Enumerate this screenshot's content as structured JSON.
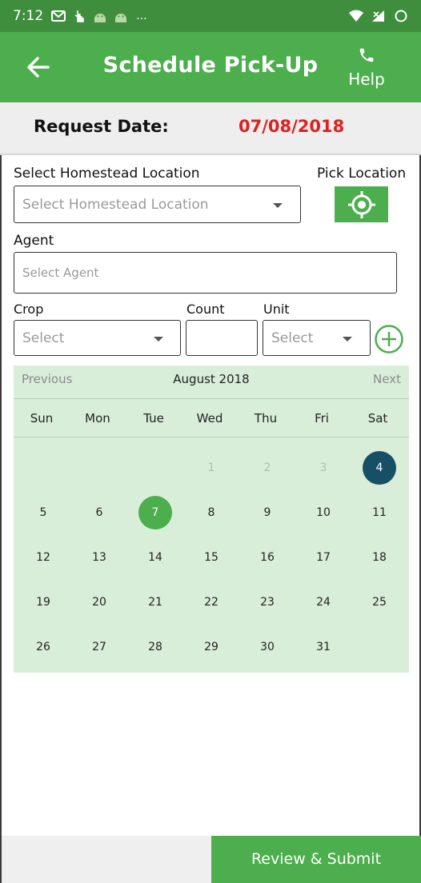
{
  "status_bar": {
    "time": "7:12",
    "left_icons": [
      "gmail-icon",
      "hand-tap-icon",
      "android-icon",
      "android-icon"
    ],
    "overflow": "...",
    "right_icons": [
      "wifi-icon",
      "signal-icon",
      "sync-circle-icon"
    ]
  },
  "app_bar": {
    "title": "Schedule Pick-Up",
    "help_label": "Help",
    "back_icon": "arrow-left-icon",
    "help_icon": "phone-icon"
  },
  "request": {
    "label": "Request Date:",
    "date": "07/08/2018"
  },
  "form": {
    "homestead_label": "Select Homestead Location",
    "homestead_placeholder": "Select Homestead Location",
    "pick_location_label": "Pick Location",
    "agent_label": "Agent",
    "agent_placeholder": "Select Agent",
    "crop_label": "Crop",
    "crop_value": "Select",
    "count_label": "Count",
    "count_value": "",
    "unit_label": "Unit",
    "unit_value": "Select"
  },
  "calendar": {
    "prev_label": "Previous",
    "month_label": "August 2018",
    "next_label": "Next",
    "weekdays": [
      "Sun",
      "Mon",
      "Tue",
      "Wed",
      "Thu",
      "Fri",
      "Sat"
    ],
    "weeks": [
      [
        "",
        "",
        "",
        "1",
        "2",
        "3",
        "4"
      ],
      [
        "5",
        "6",
        "7",
        "8",
        "9",
        "10",
        "11"
      ],
      [
        "12",
        "13",
        "14",
        "15",
        "16",
        "17",
        "18"
      ],
      [
        "19",
        "20",
        "21",
        "22",
        "23",
        "24",
        "25"
      ],
      [
        "26",
        "27",
        "28",
        "29",
        "30",
        "31",
        ""
      ]
    ],
    "disabled_days": [
      "1",
      "2",
      "3"
    ],
    "selected_day": "4",
    "today_day": "7",
    "selected_color": "#174f66",
    "today_color": "#4cae4c"
  },
  "footer": {
    "submit_label": "Review & Submit"
  },
  "colors": {
    "status_bar": "#3e8e3e",
    "primary": "#4cae4c",
    "date_red": "#e02020",
    "calendar_bg": "#d9eed9"
  }
}
